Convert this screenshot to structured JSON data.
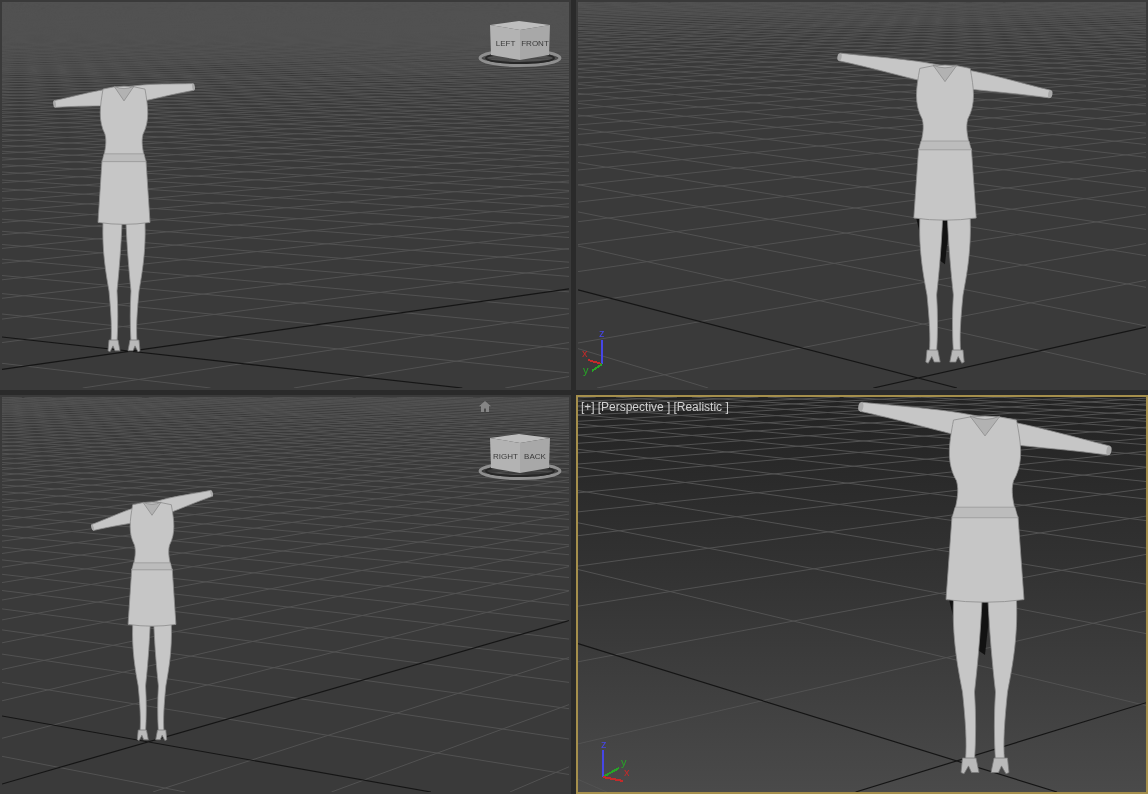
{
  "viewports": [
    {
      "selected": false,
      "view_cube": {
        "faces": [
          "LEFT",
          "FRONT"
        ]
      }
    },
    {
      "selected": false,
      "axis_gizmo": {
        "axes": [
          {
            "label": "z",
            "color": "#4646e6"
          },
          {
            "label": "x",
            "color": "#c42a2a"
          },
          {
            "label": "y",
            "color": "#26a626"
          }
        ]
      }
    },
    {
      "selected": false,
      "view_cube": {
        "faces": [
          "RIGHT",
          "BACK"
        ],
        "home_icon": true
      }
    },
    {
      "selected": true,
      "labels": [
        "[+]",
        "[Perspective ]",
        "[Realistic ]"
      ],
      "axis_gizmo": {
        "axes": [
          {
            "label": "z",
            "color": "#4646e6"
          },
          {
            "label": "y",
            "color": "#26a626"
          },
          {
            "label": "x",
            "color": "#c42a2a"
          }
        ]
      }
    }
  ]
}
